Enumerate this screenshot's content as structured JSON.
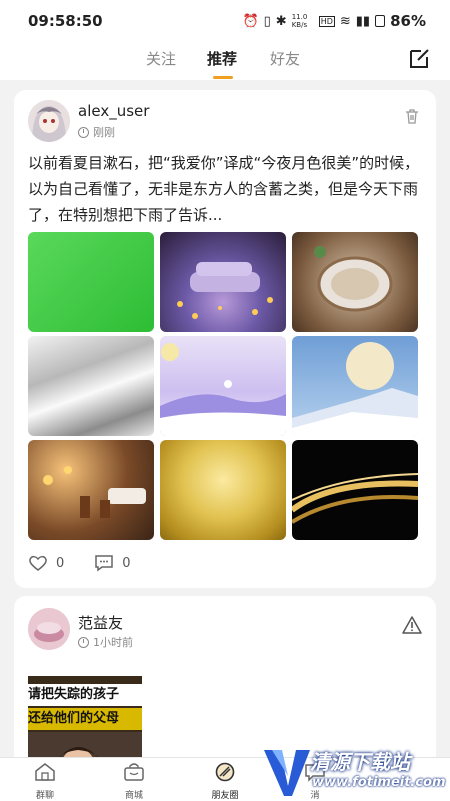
{
  "status_bar": {
    "time": "09:58:50",
    "network": "11.0 KB/s",
    "battery": "86%"
  },
  "top_tabs": [
    {
      "label": "关注"
    },
    {
      "label": "推荐"
    },
    {
      "label": "好友"
    }
  ],
  "posts": [
    {
      "username": "alex_user",
      "time": "刚刚",
      "text": "以前看夏目漱石，把“我爱你”译成“今夜月色很美”的时候，以为自己看懂了，无非是东方人的含蓄之类，但是今天下雨了，在特别想把下雨了告诉...",
      "likes": "0",
      "comments": "0"
    },
    {
      "username": "范益友",
      "time": "1小时前",
      "thumb_line1": "请把失踪的孩子",
      "thumb_line2": "还给他们的父母"
    }
  ],
  "bottom_nav": [
    {
      "label": "群聊"
    },
    {
      "label": "商城"
    },
    {
      "label": "朋友圈"
    },
    {
      "label": "消"
    }
  ],
  "watermark": {
    "title": "清源下载站",
    "url": "www.fotimeit.com"
  },
  "colors": {
    "accent": "#f0a020",
    "background": "#f2f2f2"
  }
}
